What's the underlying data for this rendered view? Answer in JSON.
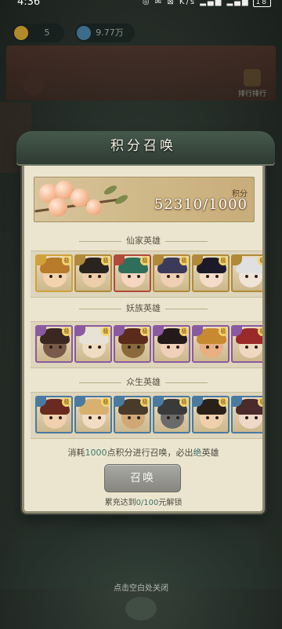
{
  "status_bar": {
    "time": "4:36",
    "icons": "◎ ✉ ⊠ K/s ▂▄▆ ▂▄▆",
    "battery": "18"
  },
  "hud": {
    "gold_value": "5",
    "jade_value": "9.77万"
  },
  "side_right_label": "排行排行",
  "dialog": {
    "title": "积分召唤",
    "score_label": "积分",
    "score_value": "52310/1000",
    "sections": [
      {
        "title": "仙家英雄",
        "badge": "极",
        "heroes": [
          {
            "hair": "#b77b2b",
            "skin": "#f3d3ae",
            "border": "#d0a23a"
          },
          {
            "hair": "#2a241f",
            "skin": "#edceaa",
            "border": "#b08a3a"
          },
          {
            "hair": "#2f6e5a",
            "skin": "#f6d6c0",
            "border": "#b04a3a"
          },
          {
            "hair": "#3c3a5a",
            "skin": "#f0d0b4",
            "border": "#b08a3a"
          },
          {
            "hair": "#1c1a28",
            "skin": "#f4dcc8",
            "border": "#b08a3a"
          },
          {
            "hair": "#e0e0e0",
            "skin": "#f0e4d8",
            "border": "#b08a3a"
          }
        ]
      },
      {
        "title": "妖族英雄",
        "badge": "极",
        "heroes": [
          {
            "hair": "#3a2820",
            "skin": "#7a5a4a",
            "border": "#8a5aa0"
          },
          {
            "hair": "#e8e2d6",
            "skin": "#f0dcc0",
            "border": "#8a5aa0"
          },
          {
            "hair": "#5a2a1a",
            "skin": "#8a6a3a",
            "border": "#8a5aa0"
          },
          {
            "hair": "#241a1a",
            "skin": "#f0d0b8",
            "border": "#8a5aa0"
          },
          {
            "hair": "#c88a30",
            "skin": "#e8b080",
            "border": "#8a5aa0"
          },
          {
            "hair": "#9a2a2a",
            "skin": "#f0d8c0",
            "border": "#8a5aa0"
          }
        ]
      },
      {
        "title": "众生英雄",
        "badge": "极",
        "heroes": [
          {
            "hair": "#6a2a20",
            "skin": "#f0d0ae",
            "border": "#4a7aa0"
          },
          {
            "hair": "#d8b070",
            "skin": "#f3dcc4",
            "border": "#4a7aa0"
          },
          {
            "hair": "#4a3a2a",
            "skin": "#d0a878",
            "border": "#4a7aa0"
          },
          {
            "hair": "#3a3a3a",
            "skin": "#6a6a6a",
            "border": "#4a7aa0"
          },
          {
            "hair": "#2a201a",
            "skin": "#f0cfac",
            "border": "#4a7aa0"
          },
          {
            "hair": "#4a2a2a",
            "skin": "#f0d8c8",
            "border": "#4a7aa0"
          }
        ]
      }
    ],
    "cost_text_1": "消耗",
    "cost_amount": "1000",
    "cost_text_2": "点积分进行召唤，必出",
    "cost_rarity": "绝",
    "cost_text_3": "英雄",
    "summon_label": "召唤",
    "unlock_text_1": "累充达到",
    "unlock_progress": "0/100",
    "unlock_text_2": "元解锁"
  },
  "close_hint": "点击空白处关闭",
  "colors": {
    "dialog_bg": "#ebe5cf",
    "header_bg": "#2e3b33",
    "accent_teal": "#3f7b6a",
    "button_disabled": "#9a9a95"
  }
}
